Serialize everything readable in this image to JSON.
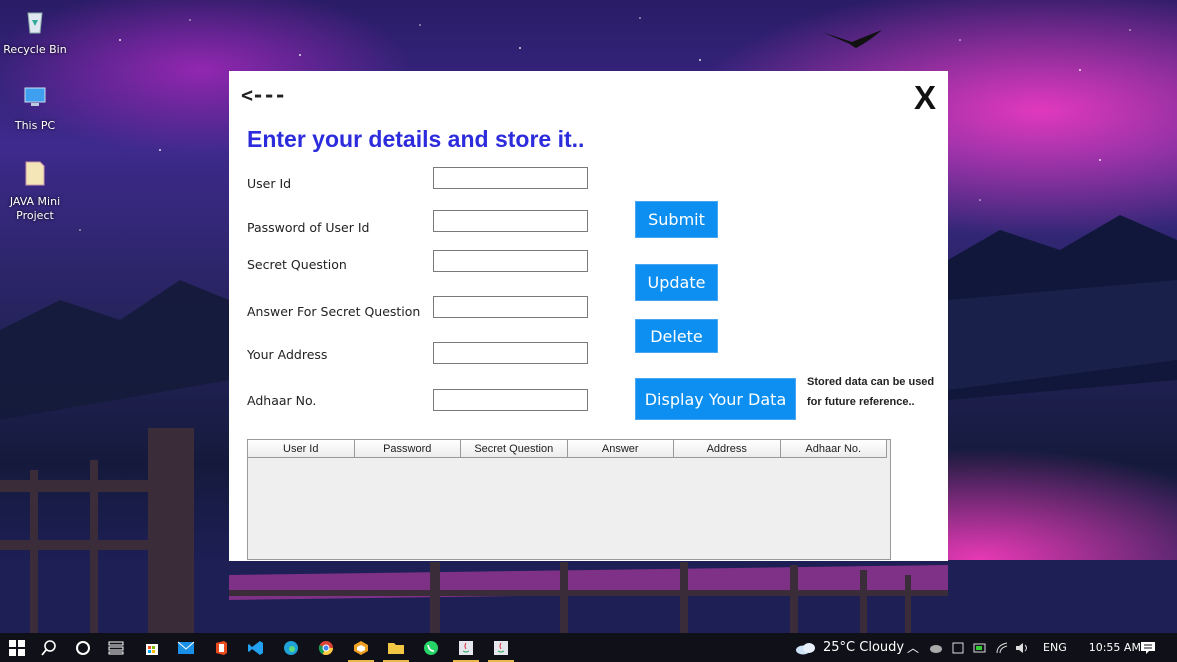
{
  "desktop": {
    "icons": [
      {
        "label": "Recycle Bin"
      },
      {
        "label": "This PC"
      },
      {
        "label": "JAVA Mini Project"
      }
    ]
  },
  "dialog": {
    "back_label": "<---",
    "close_label": "X",
    "heading": "Enter your details and store it..",
    "fields": [
      {
        "label": "User Id",
        "value": ""
      },
      {
        "label": "Password of User Id",
        "value": ""
      },
      {
        "label": "Secret Question",
        "value": ""
      },
      {
        "label": "Answer For Secret Question",
        "value": ""
      },
      {
        "label": "Your Address",
        "value": ""
      },
      {
        "label": "Adhaar No.",
        "value": ""
      }
    ],
    "buttons": {
      "submit": "Submit",
      "update": "Update",
      "delete": "Delete",
      "display": "Display Your Data"
    },
    "note_line1": "Stored data can be used",
    "note_line2": "for future reference..",
    "table": {
      "columns": [
        "User Id",
        "Password",
        "Secret Question",
        "Answer",
        "Address",
        "Adhaar No."
      ],
      "rows": []
    },
    "accent_color": "#0c8ff0",
    "heading_color": "#2c2cdd"
  },
  "taskbar": {
    "apps": [
      "windows-start",
      "search",
      "cortana",
      "task-view",
      "store",
      "mail",
      "office",
      "vscode",
      "edge",
      "chrome",
      "app-cube",
      "file-explorer",
      "whatsapp",
      "java-app-1",
      "java-app-2"
    ],
    "weather": "25°C  Cloudy",
    "language": "ENG",
    "time": "10:55 AM"
  }
}
